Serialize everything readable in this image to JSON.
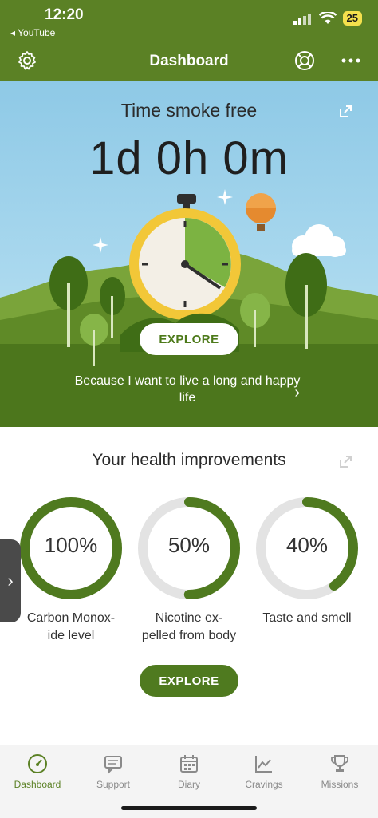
{
  "status": {
    "time": "12:20",
    "back_app": "◂ YouTube",
    "battery": "25"
  },
  "header": {
    "title": "Dashboard"
  },
  "hero": {
    "title": "Time smoke free",
    "counter": "1d 0h 0m",
    "explore_label": "EXPLORE",
    "reason": "Because I want to live a long and happy life"
  },
  "health": {
    "title": "Your health improvements",
    "items": [
      {
        "value": "100%",
        "label": "Carbon Monox-\nide level",
        "progress": 1.0
      },
      {
        "value": "50%",
        "label": "Nicotine ex-\npelled from body",
        "progress": 0.5
      },
      {
        "value": "40%",
        "label": "Taste and smell",
        "progress": 0.4
      }
    ],
    "explore_label": "EXPLORE"
  },
  "tabs": [
    {
      "label": "Dashboard",
      "icon": "gauge-icon",
      "active": true
    },
    {
      "label": "Support",
      "icon": "chat-icon",
      "active": false
    },
    {
      "label": "Diary",
      "icon": "calendar-icon",
      "active": false
    },
    {
      "label": "Cravings",
      "icon": "chart-icon",
      "active": false
    },
    {
      "label": "Missions",
      "icon": "trophy-icon",
      "active": false
    }
  ],
  "colors": {
    "brand": "#5b8125",
    "ring": "#4f7a1f",
    "ring_track": "#e3e3e3"
  }
}
